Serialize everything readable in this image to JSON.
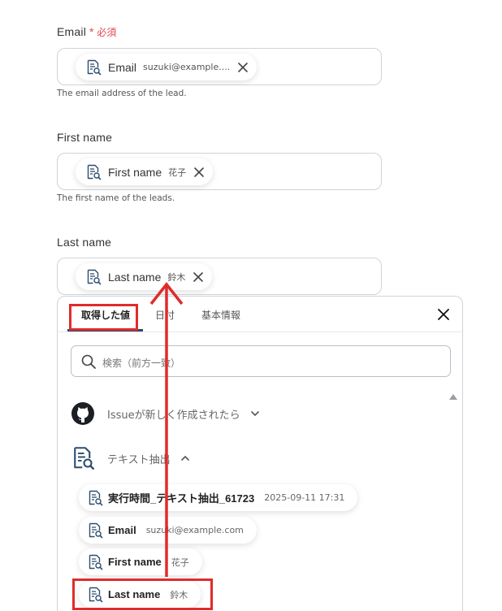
{
  "fields": [
    {
      "label": "Email",
      "required_mark": "*",
      "required_text": "必須",
      "chip_name": "Email",
      "chip_value": "suzuki@example....",
      "helper": "The email address of the lead."
    },
    {
      "label": "First name",
      "chip_name": "First name",
      "chip_value": "花子",
      "helper": "The first name of the leads."
    },
    {
      "label": "Last name",
      "chip_name": "Last name",
      "chip_value": "鈴木"
    }
  ],
  "panel": {
    "tabs": [
      "取得した値",
      "日付",
      "基本情報"
    ],
    "active_tab": "取得した値",
    "search_placeholder": "検索（前方一致）",
    "groups": [
      {
        "name": "Issueが新しく作成されたら",
        "icon": "github-icon",
        "expanded": false
      },
      {
        "name": "テキスト抽出",
        "icon": "document-search-icon",
        "expanded": true
      }
    ],
    "items": [
      {
        "name": "実行時間_テキスト抽出_61723",
        "value": "2025-09-11 17:31"
      },
      {
        "name": "Email",
        "value": "suzuki@example.com"
      },
      {
        "name": "First name",
        "value": "花子"
      },
      {
        "name": "Last name",
        "value": "鈴木"
      }
    ]
  },
  "annotations": {
    "highlight_color": "#e02b2b",
    "arrow_color": "#e02b2b"
  },
  "colors": {
    "required": "#e0464e",
    "tab_underline": "#2b4a6b",
    "border": "#cfd3d8"
  }
}
